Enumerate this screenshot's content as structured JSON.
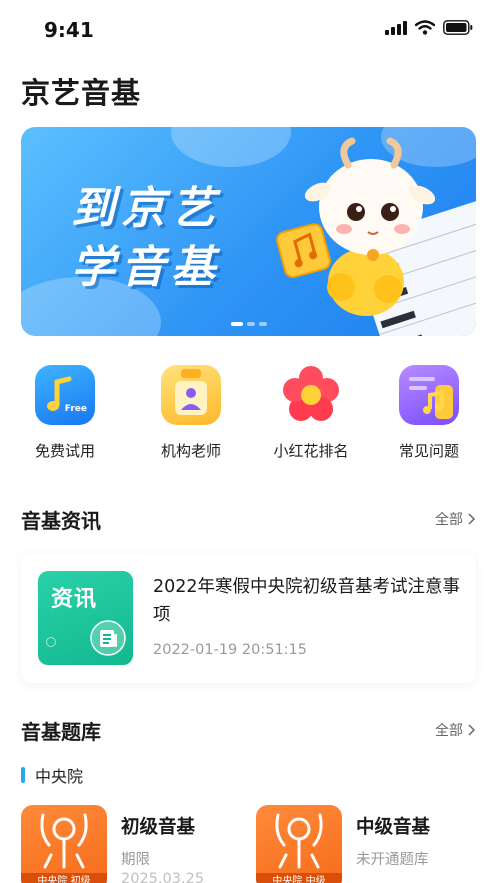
{
  "status_bar": {
    "time": "9:41"
  },
  "app": {
    "title": "京艺音基"
  },
  "banner": {
    "line1": "到京艺",
    "line2": "学音基",
    "colors": {
      "bg_start": "#5cc0ff",
      "bg_end": "#1d7ff0"
    }
  },
  "quick_nav": [
    {
      "label": "免费试用",
      "icon": "music-note-free-icon",
      "icon_text": "Free"
    },
    {
      "label": "机构老师",
      "icon": "teacher-badge-icon"
    },
    {
      "label": "小红花排名",
      "icon": "red-flower-icon"
    },
    {
      "label": "常见问题",
      "icon": "music-document-icon"
    }
  ],
  "news_section": {
    "title": "音基资讯",
    "more": "全部",
    "item": {
      "thumb_label": "资讯",
      "title": "2022年寒假中央院初级音基考试注意事项",
      "date": "2022-01-19 20:51:15"
    }
  },
  "bank_section": {
    "title": "音基题库",
    "more": "全部",
    "category": "中央院",
    "courses": [
      {
        "name": "初级音基",
        "status": "期限",
        "expire": "2025.03.25",
        "thumb_caption": "中央院 初级"
      },
      {
        "name": "中级音基",
        "status": "未开通题库",
        "thumb_caption": "中央院 中级"
      }
    ]
  },
  "colors": {
    "accent": "#22aaf0",
    "news_green": "#13b88e",
    "course_orange": "#f56b1a"
  }
}
